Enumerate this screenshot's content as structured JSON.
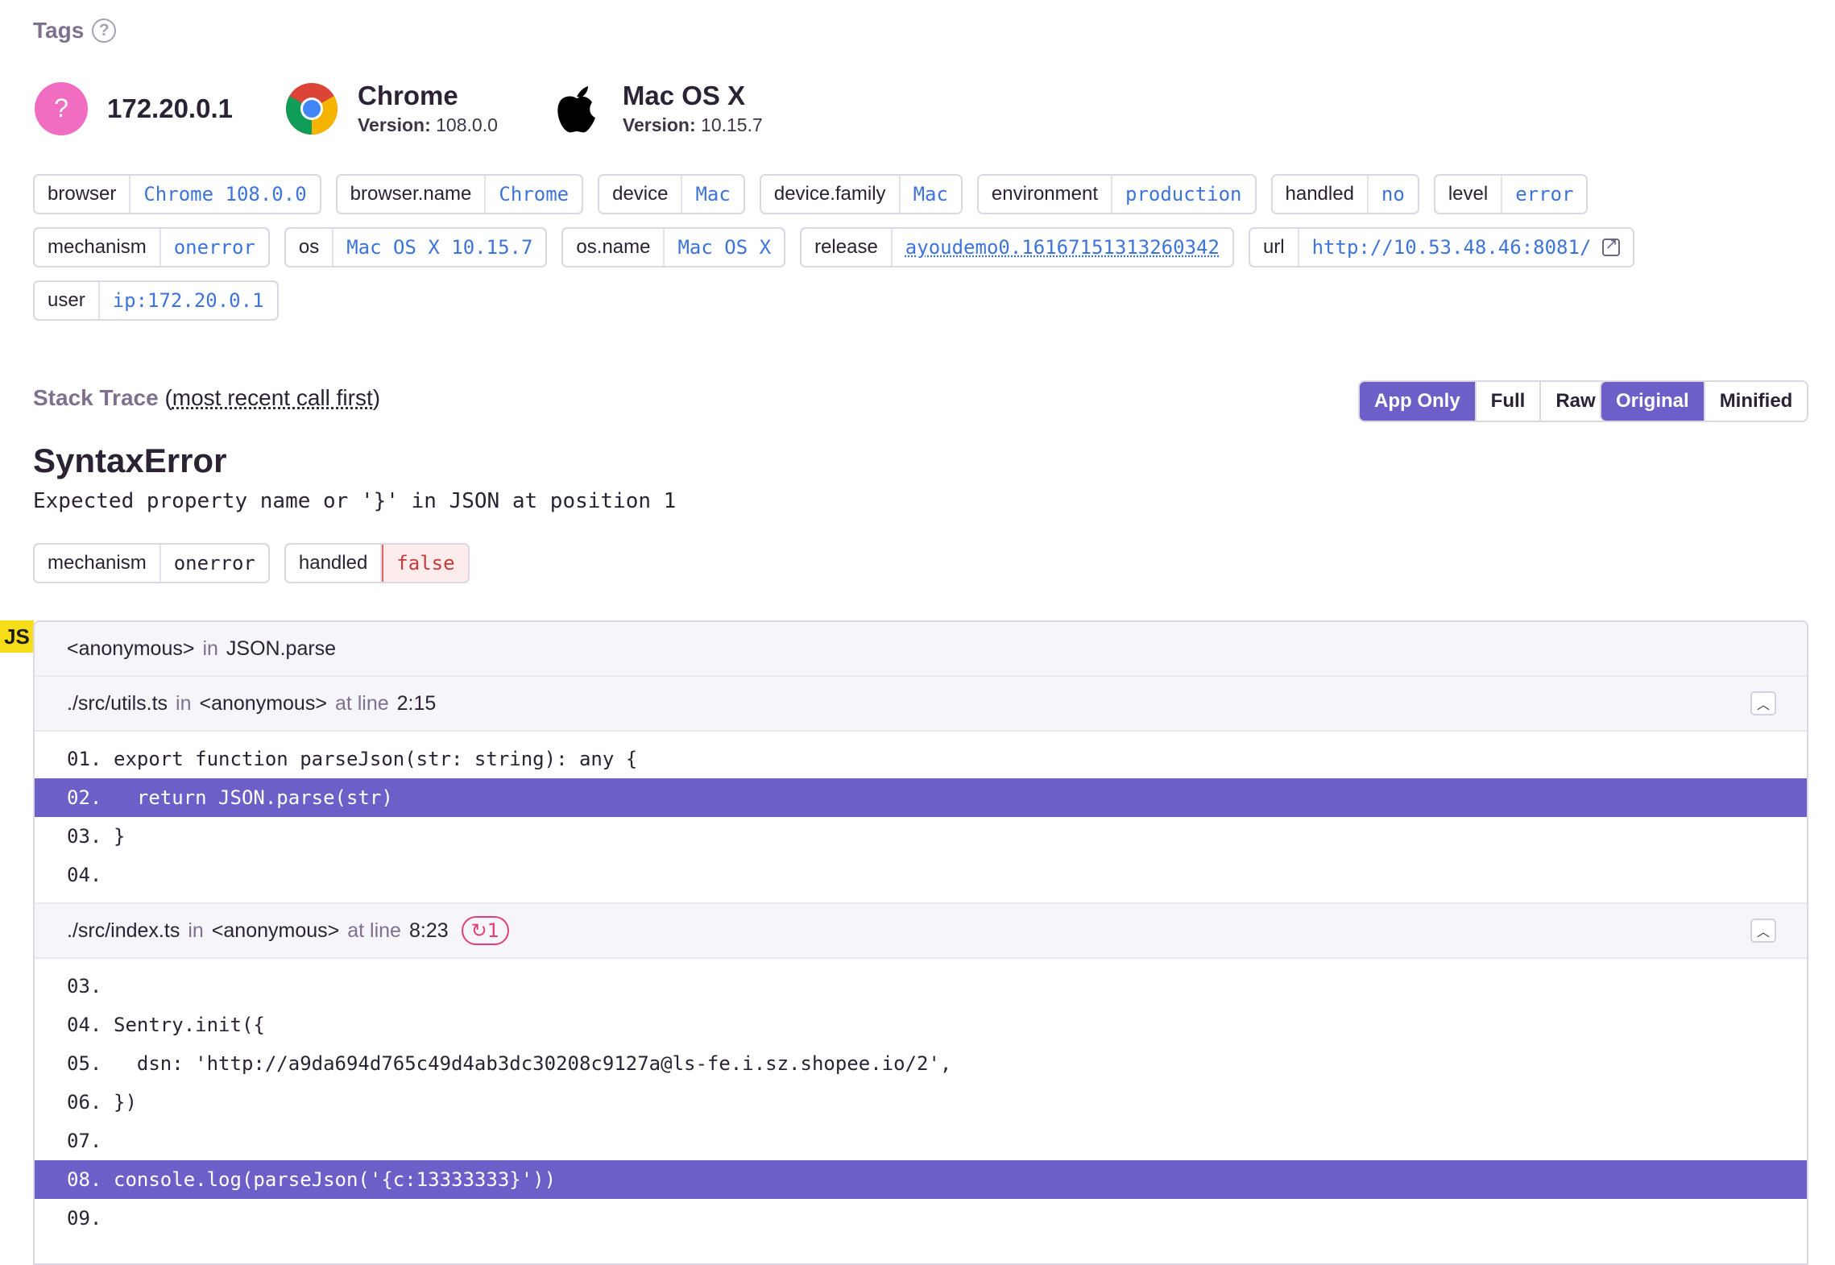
{
  "tags_section": {
    "title": "Tags",
    "help_icon": "help-circle-icon"
  },
  "context": {
    "user": {
      "icon": "?",
      "title": "172.20.0.1"
    },
    "browser": {
      "icon": "chrome-logo-icon",
      "title": "Chrome",
      "version_label": "Version:",
      "version": "108.0.0"
    },
    "os": {
      "icon": "apple-logo-icon",
      "title": "Mac OS X",
      "version_label": "Version:",
      "version": "10.15.7"
    }
  },
  "tags": {
    "row1": [
      {
        "key": "browser",
        "value": "Chrome 108.0.0"
      },
      {
        "key": "browser.name",
        "value": "Chrome"
      },
      {
        "key": "device",
        "value": "Mac"
      },
      {
        "key": "device.family",
        "value": "Mac"
      },
      {
        "key": "environment",
        "value": "production"
      },
      {
        "key": "handled",
        "value": "no"
      },
      {
        "key": "level",
        "value": "error"
      }
    ],
    "row2": [
      {
        "key": "mechanism",
        "value": "onerror"
      },
      {
        "key": "os",
        "value": "Mac OS X 10.15.7"
      },
      {
        "key": "os.name",
        "value": "Mac OS X"
      },
      {
        "key": "release",
        "value": "ayoudemo0.16167151313260342"
      },
      {
        "key": "url",
        "value": "http://10.53.48.46:8081/"
      }
    ],
    "row3": [
      {
        "key": "user",
        "value": "ip:172.20.0.1"
      }
    ]
  },
  "stack_trace": {
    "label": "Stack Trace",
    "open_paren": "(",
    "recent": "most recent call first",
    "close_paren": ")",
    "view_buttons": [
      "App Only",
      "Full",
      "Raw"
    ],
    "view_active": "App Only",
    "source_buttons": [
      "Original",
      "Minified"
    ],
    "source_active": "Original"
  },
  "exception": {
    "type": "SyntaxError",
    "value": "Expected property name or '}' in JSON at position 1",
    "mechanism": {
      "key": "mechanism",
      "value": "onerror"
    },
    "handled": {
      "key": "handled",
      "value": "false"
    }
  },
  "platform_badge": "JS",
  "frames": {
    "f1": {
      "function": "<anonymous>",
      "in": "in",
      "module": "JSON.parse"
    },
    "f2": {
      "file": "./src/utils.ts",
      "in": "in",
      "function": "<anonymous>",
      "at_line": "at line",
      "line": "2:15",
      "code": [
        {
          "ln": "01.",
          "text": "export function parseJson(str: string): any {",
          "active": false
        },
        {
          "ln": "02.",
          "text": "  return JSON.parse(str)",
          "active": true
        },
        {
          "ln": "03.",
          "text": "}",
          "active": false
        },
        {
          "ln": "04.",
          "text": "",
          "active": false
        }
      ]
    },
    "f3": {
      "file": "./src/index.ts",
      "in": "in",
      "function": "<anonymous>",
      "at_line": "at line",
      "line": "8:23",
      "repeat_count": "1",
      "code": [
        {
          "ln": "03.",
          "text": "",
          "active": false
        },
        {
          "ln": "04.",
          "text": "Sentry.init({",
          "active": false
        },
        {
          "ln": "05.",
          "text": "  dsn: 'http://a9da694d765c49d4ab3dc30208c9127a@ls-fe.i.sz.shopee.io/2',",
          "active": false
        },
        {
          "ln": "06.",
          "text": "})",
          "active": false
        },
        {
          "ln": "07.",
          "text": "",
          "active": false
        },
        {
          "ln": "08.",
          "text": "console.log(parseJson('{c:13333333}'))",
          "active": true
        },
        {
          "ln": "09.",
          "text": "",
          "active": false
        }
      ]
    }
  }
}
